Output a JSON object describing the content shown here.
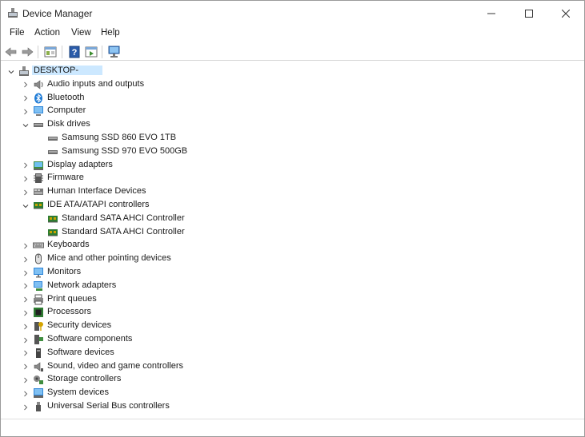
{
  "window": {
    "title": "Device Manager",
    "controls": {
      "minimize": "—",
      "maximize": "☐",
      "close": "✕"
    }
  },
  "menu": [
    "File",
    "Action",
    "View",
    "Help"
  ],
  "toolbar": {
    "buttons": [
      "back-icon",
      "forward-icon",
      "properties-icon",
      "help-icon",
      "run-icon",
      "monitor-scan-icon"
    ]
  },
  "tree": {
    "root": {
      "label": "DESKTOP-",
      "expanded": true
    },
    "items": [
      {
        "label": "Audio inputs and outputs",
        "icon": "speaker-icon",
        "expanded": false
      },
      {
        "label": "Bluetooth",
        "icon": "bluetooth-icon",
        "expanded": false
      },
      {
        "label": "Computer",
        "icon": "computer-icon",
        "expanded": false
      },
      {
        "label": "Disk drives",
        "icon": "disk-drive-icon",
        "expanded": true,
        "children": [
          "Samsung SSD 860 EVO 1TB",
          "Samsung SSD 970 EVO 500GB"
        ]
      },
      {
        "label": "Display adapters",
        "icon": "display-adapter-icon",
        "expanded": false
      },
      {
        "label": "Firmware",
        "icon": "firmware-icon",
        "expanded": false
      },
      {
        "label": "Human Interface Devices",
        "icon": "hid-icon",
        "expanded": false
      },
      {
        "label": "IDE ATA/ATAPI controllers",
        "icon": "ide-controller-icon",
        "expanded": true,
        "children": [
          "Standard SATA AHCI Controller",
          "Standard SATA AHCI Controller"
        ]
      },
      {
        "label": "Keyboards",
        "icon": "keyboard-icon",
        "expanded": false
      },
      {
        "label": "Mice and other pointing devices",
        "icon": "mouse-icon",
        "expanded": false
      },
      {
        "label": "Monitors",
        "icon": "monitor-icon",
        "expanded": false
      },
      {
        "label": "Network adapters",
        "icon": "network-adapter-icon",
        "expanded": false
      },
      {
        "label": "Print queues",
        "icon": "printer-icon",
        "expanded": false
      },
      {
        "label": "Processors",
        "icon": "processor-icon",
        "expanded": false
      },
      {
        "label": "Security devices",
        "icon": "security-device-icon",
        "expanded": false
      },
      {
        "label": "Software components",
        "icon": "software-component-icon",
        "expanded": false
      },
      {
        "label": "Software devices",
        "icon": "software-device-icon",
        "expanded": false
      },
      {
        "label": "Sound, video and game controllers",
        "icon": "sound-controller-icon",
        "expanded": false
      },
      {
        "label": "Storage controllers",
        "icon": "storage-controller-icon",
        "expanded": false
      },
      {
        "label": "System devices",
        "icon": "system-device-icon",
        "expanded": false
      },
      {
        "label": "Universal Serial Bus controllers",
        "icon": "usb-icon",
        "expanded": false
      }
    ]
  },
  "colors": {
    "selection": "#cce8ff",
    "accent_blue": "#1e7bd6"
  }
}
